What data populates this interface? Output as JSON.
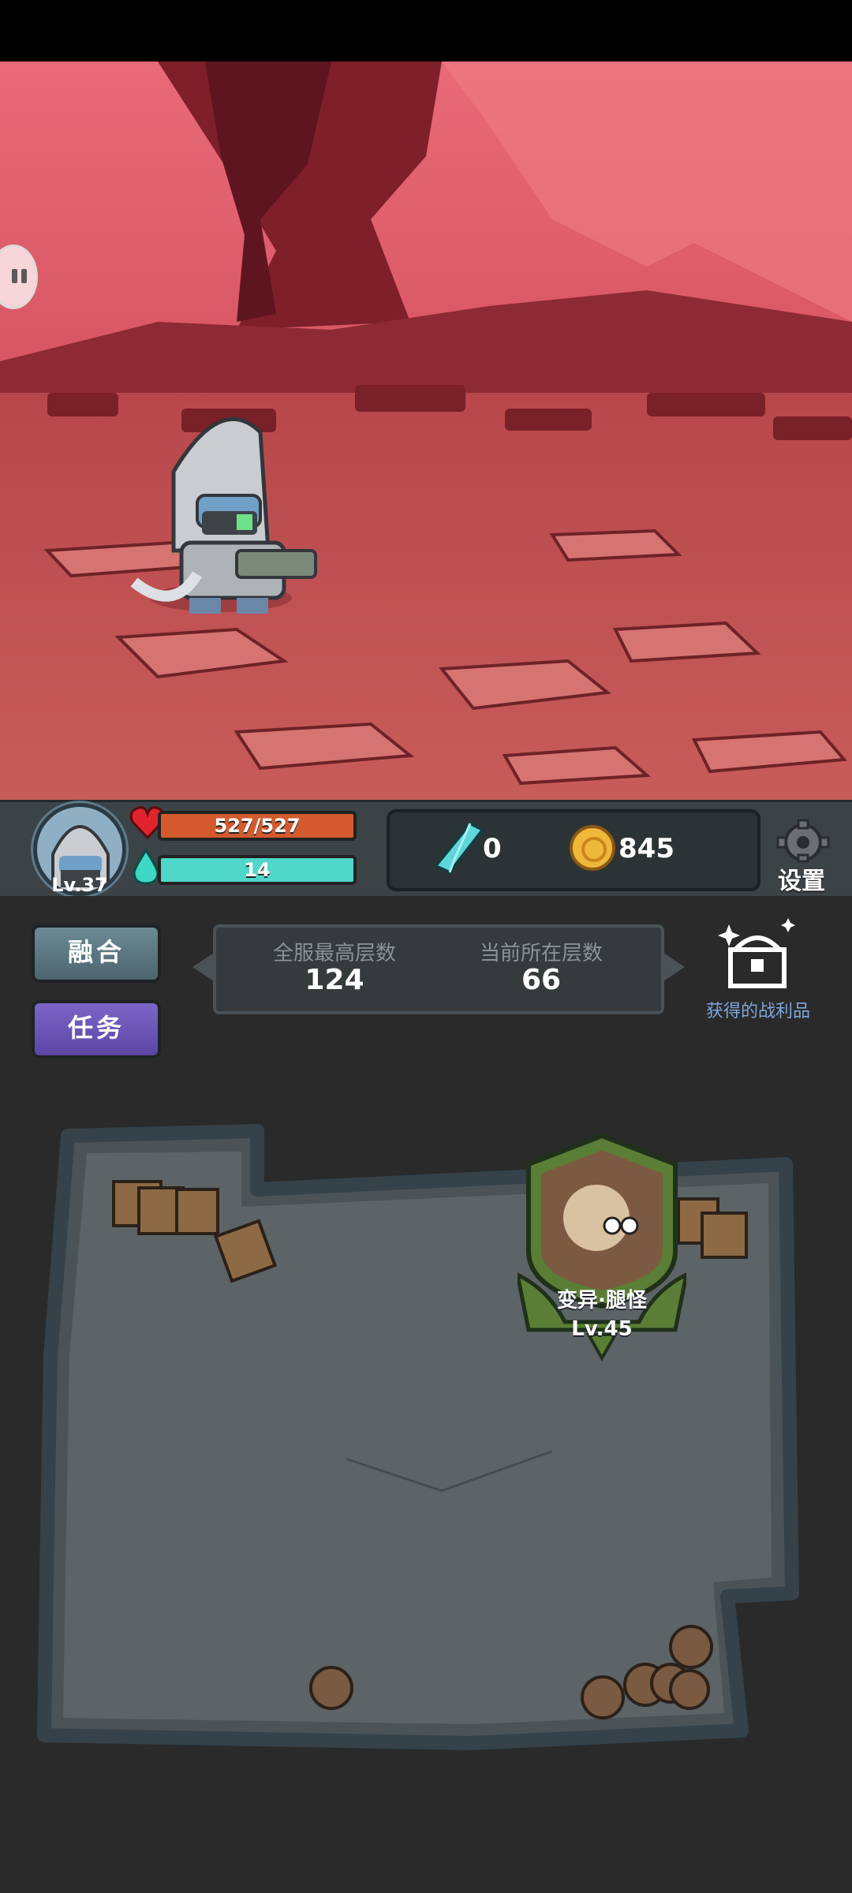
{
  "player": {
    "level": "Lv.37"
  },
  "stats": {
    "hp": "527/527",
    "mp": "14"
  },
  "resources": {
    "gems": "0",
    "coins": "845",
    "settings_label": "设置"
  },
  "buttons": {
    "fuse_label": "融合",
    "task_label": "任务"
  },
  "floors": {
    "server_best_label": "全服最高层数",
    "server_best_value": "124",
    "current_label": "当前所在层数",
    "current_value": "66"
  },
  "loot": {
    "label": "获得的战利品"
  },
  "monster": {
    "name": "变异·腿怪",
    "level": "Lv.45"
  },
  "colors": {
    "hp_bar": "#d45a2d",
    "mp_bar": "#4fd7c9",
    "task_button": "#6a55b8",
    "fuse_button": "#5d7a84"
  }
}
